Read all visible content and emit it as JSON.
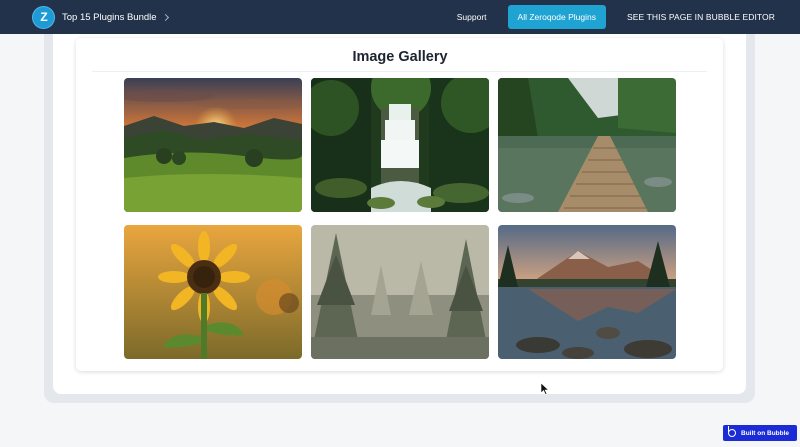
{
  "header": {
    "logo_text": "Z",
    "brand": "Top 15 Plugins Bundle",
    "nav": {
      "support": "Support",
      "all_plugins": "All Zeroqode Plugins",
      "editor": "SEE THIS PAGE IN BUBBLE EDITOR"
    },
    "colors": {
      "bar": "#22324a",
      "accent": "#1fa3d2"
    }
  },
  "gallery": {
    "title": "Image Gallery",
    "images": [
      {
        "name": "mountain-sunset",
        "icon": "landscape-image"
      },
      {
        "name": "forest-waterfall",
        "icon": "landscape-image"
      },
      {
        "name": "lake-boardwalk",
        "icon": "landscape-image"
      },
      {
        "name": "sunflower",
        "icon": "landscape-image"
      },
      {
        "name": "misty-forest",
        "icon": "landscape-image"
      },
      {
        "name": "mountain-lake-reflection",
        "icon": "landscape-image"
      }
    ]
  },
  "footer": {
    "badge": "Built on Bubble",
    "badge_color": "#1b2bd6"
  }
}
